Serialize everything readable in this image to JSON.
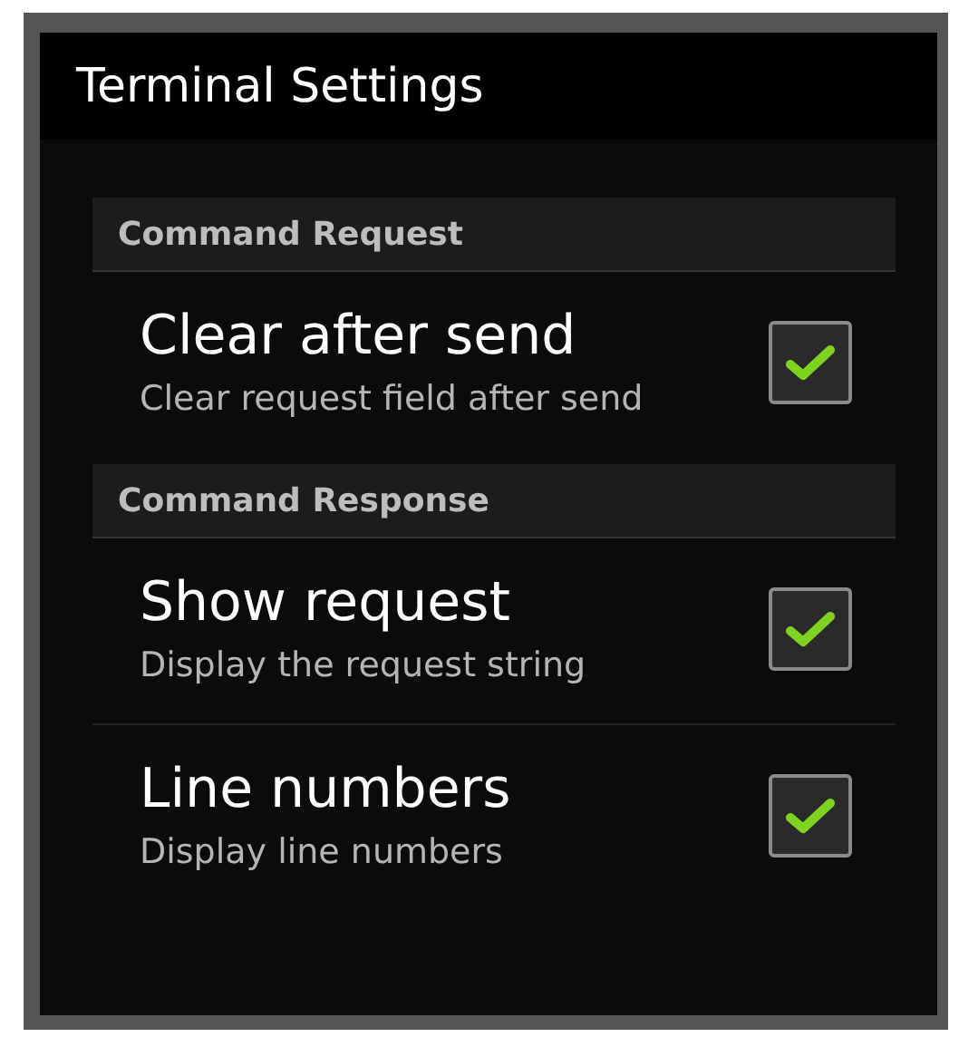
{
  "window": {
    "title": "Terminal Settings"
  },
  "sections": [
    {
      "header": "Command Request",
      "items": [
        {
          "title": "Clear after send",
          "summary": "Clear request field after send",
          "checked": true
        }
      ]
    },
    {
      "header": "Command Response",
      "items": [
        {
          "title": "Show request",
          "summary": "Display the request string",
          "checked": true
        },
        {
          "title": "Line numbers",
          "summary": "Display line numbers",
          "checked": true
        }
      ]
    }
  ]
}
